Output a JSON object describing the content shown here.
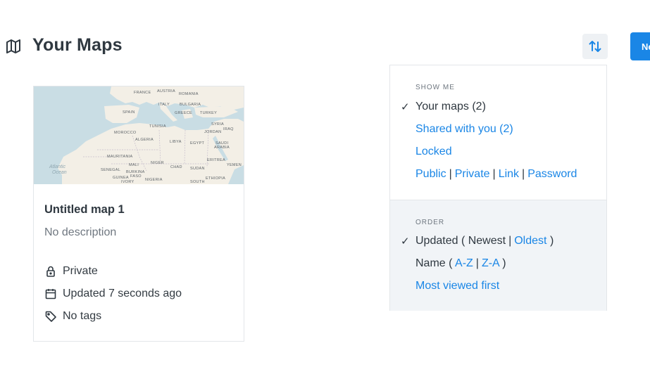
{
  "header": {
    "title": "Your Maps",
    "title_icon": "map-icon",
    "sort_icon": "sort-arrows-icon",
    "new_button_label": "New"
  },
  "card": {
    "title": "Untitled map 1",
    "description": "No description",
    "privacy": "Private",
    "updated": "Updated 7 seconds ago",
    "tags": "No tags",
    "thumbnail_labels": [
      "FRANCE",
      "AUSTRIA",
      "ROMANIA",
      "ITALY",
      "BULGARIA",
      "SPAIN",
      "GREECE",
      "TURKEY",
      "TUNISIA",
      "SYRIA",
      "MOROCCO",
      "ALGERIA",
      "LIBYA",
      "EGYPT",
      "JORDAN",
      "IRAQ",
      "SAUDI ARABIA",
      "MAURITANIA",
      "MALI",
      "NIGER",
      "CHAD",
      "SUDAN",
      "ERITREA",
      "YEMEN",
      "SENEGAL",
      "BURKINA FASO",
      "GUINEA",
      "NIGERIA",
      "IVORY",
      "SOUTH",
      "ETHIOPIA",
      "Atlantic Ocean"
    ]
  },
  "dropdown": {
    "show_heading": "SHOW ME",
    "your_maps": "Your maps (2)",
    "shared": "Shared with you (2)",
    "locked": "Locked",
    "public": "Public",
    "private": "Private",
    "link": "Link",
    "password": "Password",
    "order_heading": "ORDER",
    "updated_prefix": "Updated (",
    "newest": "Newest",
    "oldest": "Oldest",
    "name_prefix": "Name (",
    "az": "A-Z",
    "za": "Z-A",
    "close_paren": ")",
    "most_viewed": "Most viewed first",
    "pipe": "|",
    "check": "✓"
  },
  "colors": {
    "accent": "#1a86e6",
    "text": "#2f3840",
    "muted": "#6f7780",
    "land": "#f3efe6",
    "water": "#c9dde4"
  }
}
